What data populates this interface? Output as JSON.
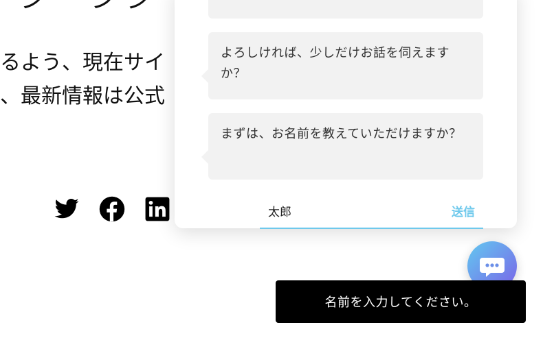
{
  "background": {
    "heading_fragment": "ーシ ー ン ジ ー",
    "line1": "るよう、現在サイ",
    "line2": "、最新情報は公式",
    "social_icons": [
      "twitter-icon",
      "facebook-icon",
      "linkedin-icon"
    ]
  },
  "chat": {
    "messages": [
      "",
      "よろしければ、少しだけお話を伺えますか？",
      "まずは、お名前を教えていただけますか？"
    ],
    "input_value": "太郎",
    "send_label": "送信",
    "accent_color": "#6fc9ec"
  },
  "fab": {
    "icon": "chat-bubble-icon"
  },
  "toast": {
    "text": "名前を入力してください。"
  }
}
